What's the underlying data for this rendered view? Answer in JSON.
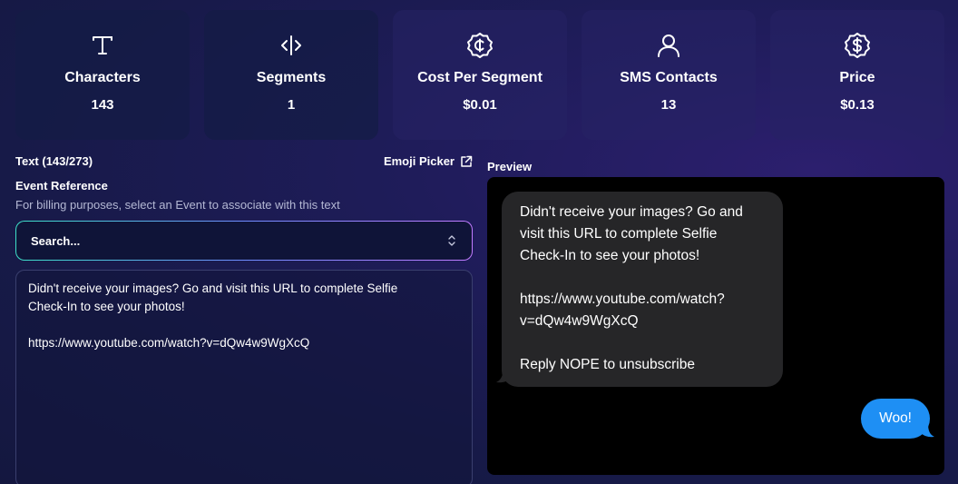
{
  "stats": [
    {
      "icon": "text-t-icon",
      "label": "Characters",
      "value": "143"
    },
    {
      "icon": "code-divider-icon",
      "label": "Segments",
      "value": "1"
    },
    {
      "icon": "cent-coin-icon",
      "label": "Cost Per Segment",
      "value": "$0.01"
    },
    {
      "icon": "user-icon",
      "label": "SMS Contacts",
      "value": "13"
    },
    {
      "icon": "dollar-coin-icon",
      "label": "Price",
      "value": "$0.13"
    }
  ],
  "editor": {
    "text_label": "Text (143/273)",
    "emoji_picker_label": "Emoji Picker",
    "event_reference_title": "Event Reference",
    "event_reference_hint": "For billing purposes, select an Event to associate with this text",
    "event_select_placeholder": "Search...",
    "message_text": "Didn't receive your images? Go and visit this URL to complete Selfie\nCheck-In to see your photos!\n\nhttps://www.youtube.com/watch?v=dQw4w9WgXcQ"
  },
  "preview": {
    "label": "Preview",
    "incoming": {
      "line1": "Didn't receive your images? Go and visit this URL to complete Selfie Check-In to see your photos!",
      "line2": "https://www.youtube.com/watch?v=dQw4w9WgXcQ",
      "line3": "Reply NOPE to unsubscribe"
    },
    "outgoing": "Woo!"
  },
  "colors": {
    "accent_blue": "#1e8ff4",
    "bubble_gray": "#262628",
    "background": "#1f1c5a"
  }
}
